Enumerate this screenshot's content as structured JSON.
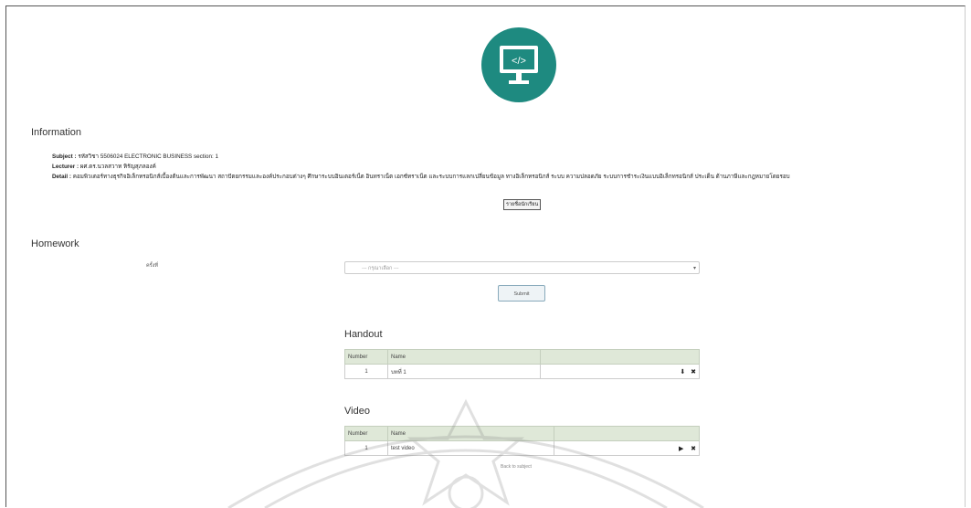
{
  "information": {
    "title": "Information",
    "subject_label": "Subject :",
    "subject_value": "รหัสวิชา 5506024 ELECTRONIC BUSINESS section: 1",
    "lecturer_label": "Lecturer :",
    "lecturer_value": "ผศ.ดร.นวลสวาท หิรัญสุภลองค์",
    "detail_label": "Detail :",
    "detail_value": "คอมพิวเตอร์ทางธุรกิจอิเล็กทรอนิกส์เบื้องต้นและการพัฒนา สถาปัตยกรรมและองค์ประกอบต่างๆ ศึกษาระบบอินเตอร์เน็ต อินทราเน็ต เอกซ์ทราเน็ต และระบบการแลกเปลี่ยนข้อมูล ทางอิเล็กทรอนิกส์ ระบบ ความปลอดภัย ระบบการชำระเงินแบบอิเล็กทรอนิกส์ ประเด็น ด้านภาษีและกฎหมายโดยรอบ",
    "button_label": "รายชื่อนักเรียน"
  },
  "homework": {
    "title": "Homework",
    "label": "ครั้งที่",
    "select_placeholder": "--- กรุณาเลือก ---",
    "submit_label": "Submit"
  },
  "handout": {
    "title": "Handout",
    "columns": [
      "Number",
      "Name"
    ],
    "rows": [
      {
        "number": "1",
        "name": "บทที่ 1"
      }
    ]
  },
  "video": {
    "title": "Video",
    "columns": [
      "Number",
      "Name"
    ],
    "rows": [
      {
        "number": "1",
        "name": "test video"
      }
    ]
  },
  "footer": {
    "back_label": "Back to subject"
  },
  "icons": {
    "logo": "code-monitor-icon",
    "download": "download-icon",
    "delete": "close-icon",
    "play": "play-icon"
  },
  "colors": {
    "logo_bg": "#1e8a80",
    "table_header": "#dfe8d8"
  }
}
